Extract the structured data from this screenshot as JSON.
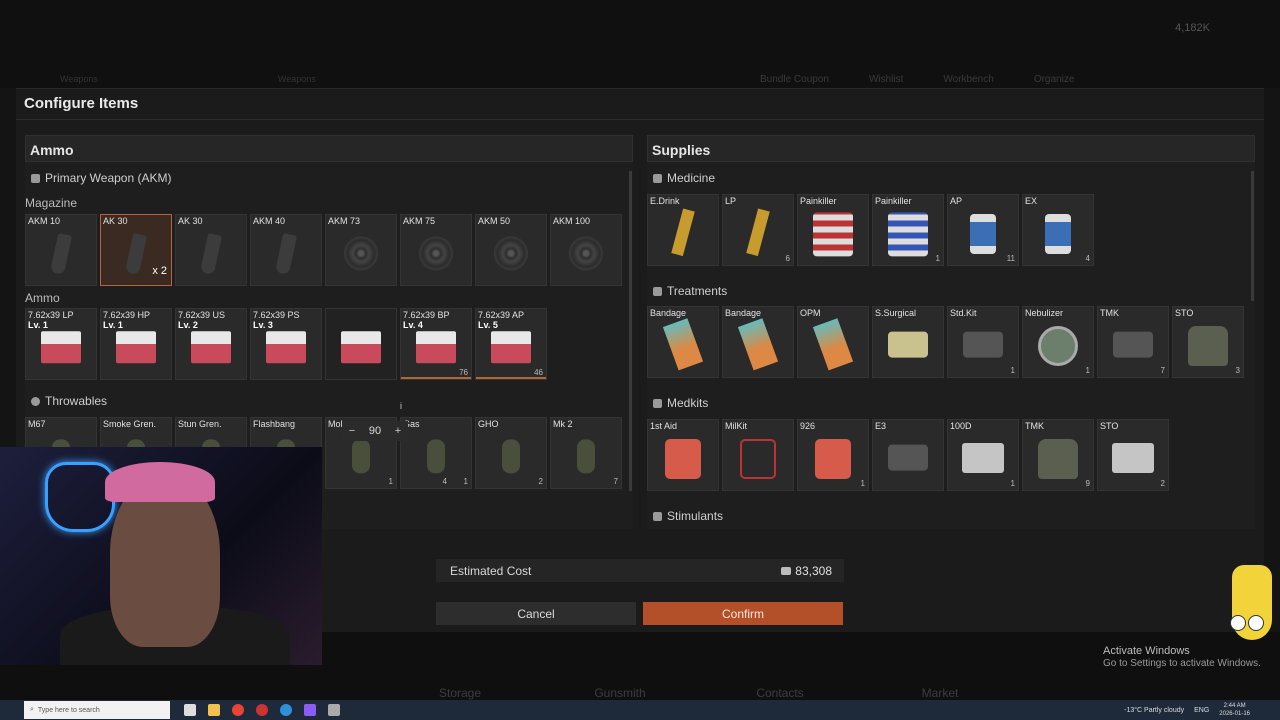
{
  "background": {
    "currency": "4,182K",
    "top_tabs": [
      "Bundle Coupon",
      "Wishlist",
      "Workbench",
      "Organize"
    ],
    "left_tabs": [
      "Weapons",
      "Weapons"
    ],
    "nav_tabs": [
      "Storage",
      "Gunsmith",
      "Contacts",
      "Market"
    ]
  },
  "modal": {
    "title": "Configure Items",
    "ammo": {
      "title": "Ammo",
      "primary_weapon": "Primary Weapon (AKM)",
      "magazine_label": "Magazine",
      "magazines": [
        {
          "name": "AKM 10"
        },
        {
          "name": "AK 30",
          "multiplier": "x 2",
          "selected": true
        },
        {
          "name": "AK 30"
        },
        {
          "name": "AKM 40"
        },
        {
          "name": "AKM 73"
        },
        {
          "name": "AKM 75"
        },
        {
          "name": "AKM 50"
        },
        {
          "name": "AKM 100"
        }
      ],
      "ammo_label": "Ammo",
      "ammo_items": [
        {
          "name": "7.62x39 LP",
          "level": "Lv. 1"
        },
        {
          "name": "7.62x39 HP",
          "level": "Lv. 1"
        },
        {
          "name": "7.62x39 US",
          "level": "Lv. 2"
        },
        {
          "name": "7.62x39 PS",
          "level": "Lv. 3"
        },
        {
          "name": "",
          "level": ""
        },
        {
          "name": "7.62x39 BP",
          "level": "Lv. 4",
          "count": "76",
          "bar_color": "#b0682f"
        },
        {
          "name": "7.62x39 AP",
          "level": "Lv. 5",
          "count": "46",
          "bar_color": "#b0682f"
        }
      ],
      "stepper_value": "90",
      "throwables_label": "Throwables",
      "throwables": [
        {
          "name": "M67"
        },
        {
          "name": "Smoke Gren."
        },
        {
          "name": "Stun Gren."
        },
        {
          "name": "Flashbang"
        },
        {
          "name": "Molotov",
          "count": "1"
        },
        {
          "name": "Gas",
          "count": "1",
          "count2": "4"
        },
        {
          "name": "GHO",
          "count": "2"
        },
        {
          "name": "Mk 2",
          "count": "7"
        }
      ]
    },
    "supplies": {
      "title": "Supplies",
      "medicine_label": "Medicine",
      "medicine": [
        {
          "name": "E.Drink",
          "art": "med1"
        },
        {
          "name": "LP",
          "count": "6",
          "art": "med1"
        },
        {
          "name": "Painkiller",
          "art": "pill"
        },
        {
          "name": "Painkiller",
          "count": "1",
          "art": "pill blue"
        },
        {
          "name": "AP",
          "count": "11",
          "art": "bottle"
        },
        {
          "name": "EX",
          "count": "4",
          "art": "bottle"
        }
      ],
      "treatments_label": "Treatments",
      "treatments": [
        {
          "name": "Bandage",
          "art": "bandage"
        },
        {
          "name": "Bandage",
          "art": "bandage"
        },
        {
          "name": "OPM",
          "art": "bandage"
        },
        {
          "name": "S.Surgical",
          "art": "pack"
        },
        {
          "name": "Std.Kit",
          "count": "1",
          "art": "pack gray"
        },
        {
          "name": "Nebulizer",
          "count": "1",
          "art": "round"
        },
        {
          "name": "TMK",
          "count": "7",
          "art": "pack gray"
        },
        {
          "name": "STO",
          "count": "3",
          "art": "bag"
        }
      ],
      "medkits_label": "Medkits",
      "medkits": [
        {
          "name": "1st Aid",
          "art": "kit"
        },
        {
          "name": "MilKit",
          "art": "kit red"
        },
        {
          "name": "926",
          "count": "1",
          "art": "kit"
        },
        {
          "name": "E3",
          "art": "pack gray"
        },
        {
          "name": "100D",
          "count": "1",
          "art": "box"
        },
        {
          "name": "TMK",
          "count": "9",
          "art": "bag"
        },
        {
          "name": "STO",
          "count": "2",
          "art": "box"
        }
      ],
      "stimulants_label": "Stimulants"
    },
    "estimated_cost_label": "Estimated Cost",
    "estimated_cost_value": "83,308",
    "cancel_label": "Cancel",
    "confirm_label": "Confirm"
  },
  "activate_windows": {
    "title": "Activate Windows",
    "subtitle": "Go to Settings to activate Windows."
  },
  "taskbar": {
    "search_placeholder": "Type here to search",
    "weather": "-13°C  Partly cloudy",
    "language": "ENG",
    "time": "2:44 AM",
    "date": "2026-01-16"
  }
}
